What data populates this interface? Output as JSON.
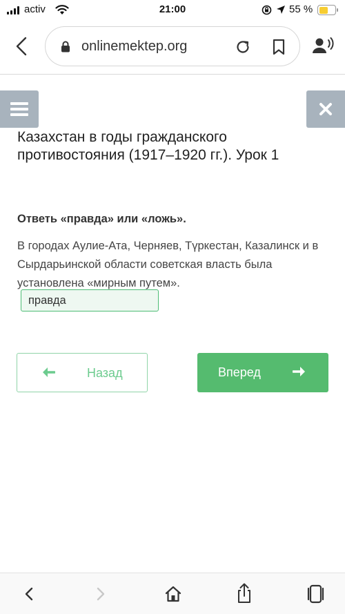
{
  "status_bar": {
    "carrier": "activ",
    "time": "21:00",
    "battery_percent": "55 %",
    "battery_level": 0.55,
    "battery_color": "#f7cd32"
  },
  "browser": {
    "url": "onlinemektep.org",
    "icons": [
      "chevron-left-icon",
      "padlock-icon",
      "reload-icon",
      "bookmark-icon",
      "reader-voice-icon"
    ]
  },
  "page": {
    "title": "Казахстан в годы гражданского противостояния (1917–1920 гг.). Урок 1",
    "instruction": "Ответь «правда» или «ложь».",
    "question": "В городах Аулие-Ата, Черняев, Түркестан, Казалинск и в Сырдарьинской области советская власть была установлена «мирным путем».",
    "selected_answer": "правда",
    "back_label": "Назад",
    "next_label": "Вперед",
    "colors": {
      "accent_green": "#55bb6f",
      "panel_button_gray": "#a8b3bd"
    }
  },
  "toolbar": {
    "icons": [
      "back-icon",
      "forward-icon",
      "home-icon",
      "share-icon",
      "tabs-icon"
    ]
  }
}
